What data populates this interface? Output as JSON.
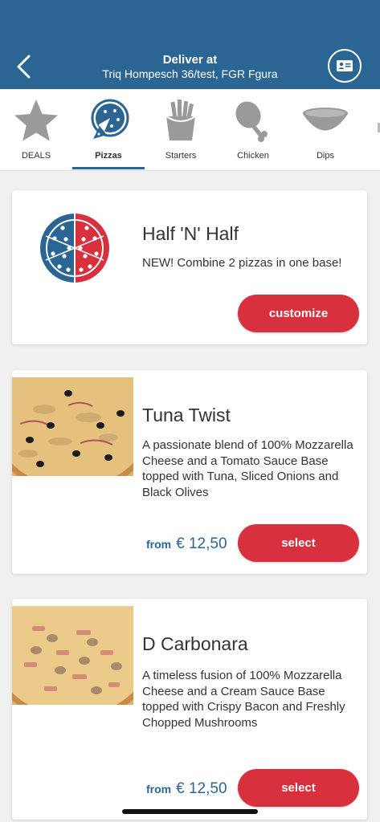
{
  "header": {
    "deliver_label": "Deliver at",
    "address": "Triq Hompesch 36/test, FGR Fgura",
    "back_icon": "chevron-left-icon",
    "profile_icon": "id-card-icon",
    "bg_color": "#2a6593"
  },
  "tabs": [
    {
      "label": "DEALS",
      "icon": "star-icon",
      "active": false
    },
    {
      "label": "Pizzas",
      "icon": "pizza-icon",
      "active": true
    },
    {
      "label": "Starters",
      "icon": "fries-icon",
      "active": false
    },
    {
      "label": "Chicken",
      "icon": "drumstick-icon",
      "active": false
    },
    {
      "label": "Dips",
      "icon": "dip-bowl-icon",
      "active": false
    }
  ],
  "products": [
    {
      "title": "Half 'N' Half",
      "description": "NEW! Combine 2 pizzas in one base!",
      "button": "customize",
      "image": "half-half-pizza-icon"
    },
    {
      "title": "Tuna Twist",
      "description": "A passionate blend of 100% Mozzarella Cheese and a Tomato Sauce Base topped with  Tuna, Sliced Onions and Black Olives",
      "price_prefix": "from",
      "price": "€ 12,50",
      "button": "select",
      "image": "tuna-twist-pizza-photo"
    },
    {
      "title": "D Carbonara",
      "description": "A timeless fusion of 100% Mozzarella Cheese and a Cream Sauce Base topped with Crispy Bacon and Freshly Chopped Mushrooms",
      "price_prefix": "from",
      "price": "€ 12,50",
      "button": "select",
      "image": "carbonara-pizza-photo"
    }
  ],
  "colors": {
    "brand_blue": "#2a6593",
    "button_red": "#d9303d",
    "icon_grey": "#9a9a9a"
  }
}
